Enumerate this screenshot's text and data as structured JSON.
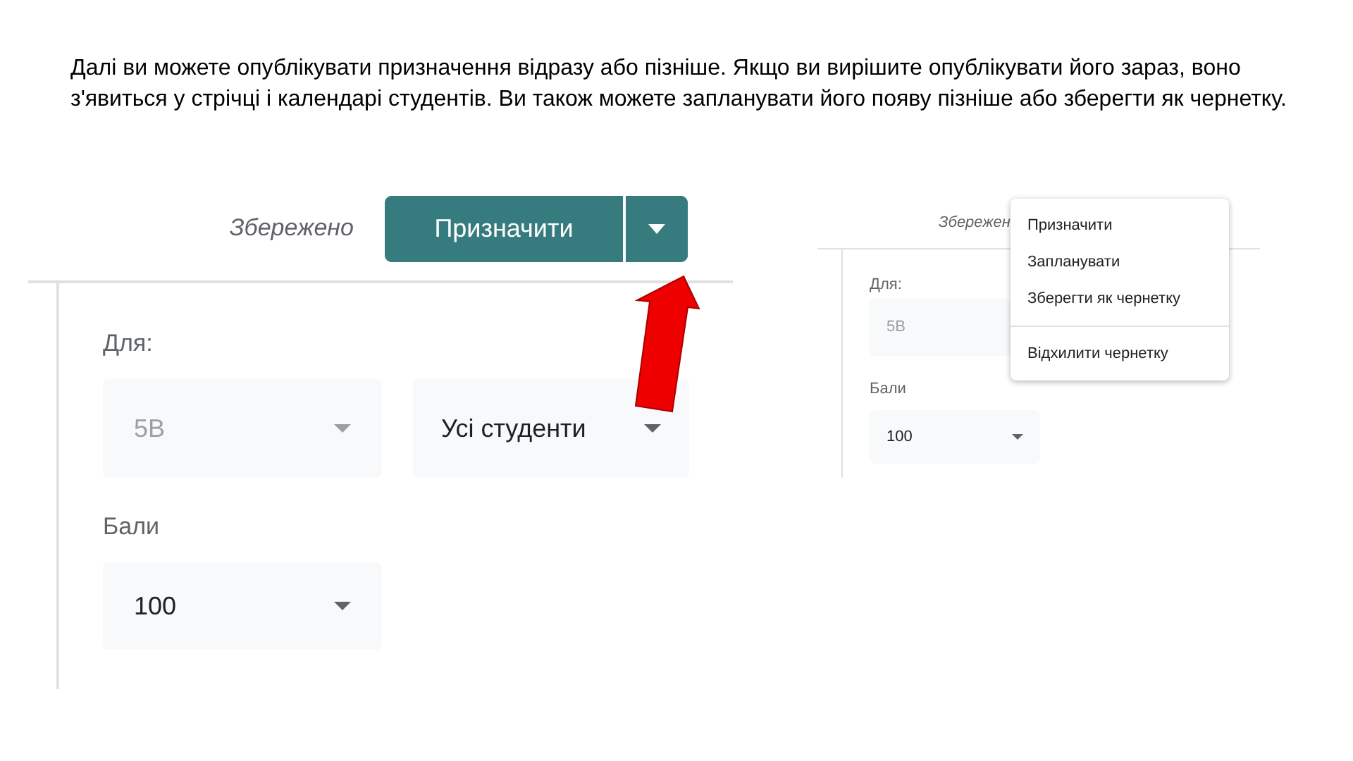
{
  "instructions": "Далі ви можете опублікувати призначення відразу або пізніше. Якщо ви вирішите опублікувати його зараз, воно з'явиться у стрічці і календарі студентів. Ви також можете запланувати його появу пізніше або зберегти як чернетку.",
  "large_view": {
    "saved_label": "Збережено",
    "assign_button": "Призначити",
    "for_label": "Для:",
    "class_select": {
      "value": "5В",
      "disabled": true
    },
    "students_select": {
      "value": "Усі студенти",
      "disabled": false
    },
    "points_label": "Бали",
    "points_select": {
      "value": "100",
      "disabled": false
    }
  },
  "small_view": {
    "saved_label": "Збережен",
    "for_label": "Для:",
    "class_select": {
      "value": "5В",
      "disabled": true
    },
    "points_label": "Бали",
    "points_select": {
      "value": "100",
      "disabled": false
    },
    "menu_groups": [
      {
        "items": [
          "Призначити",
          "Запланувати",
          "Зберегти як чернетку"
        ]
      },
      {
        "items": [
          "Відхилити чернетку"
        ]
      }
    ]
  }
}
